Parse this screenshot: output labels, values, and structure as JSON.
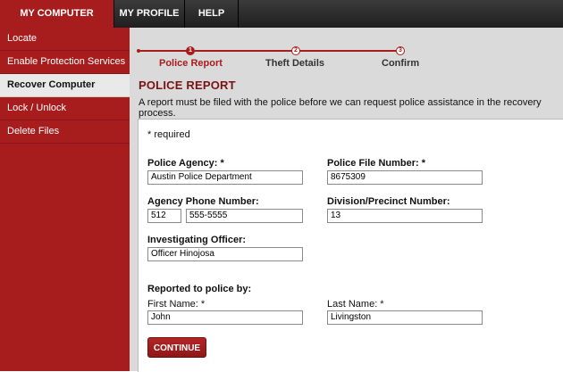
{
  "topnav": {
    "tabs": [
      {
        "label": "MY COMPUTER",
        "active": true
      },
      {
        "label": "MY PROFILE",
        "active": false
      },
      {
        "label": "HELP",
        "active": false
      }
    ]
  },
  "sidebar": {
    "items": [
      {
        "label": "Locate"
      },
      {
        "label": "Enable Protection Services"
      },
      {
        "label": "Recover Computer",
        "active": true
      },
      {
        "label": "Lock / Unlock"
      },
      {
        "label": "Delete Files"
      }
    ]
  },
  "steps": [
    {
      "number": "1",
      "label": "Police Report",
      "state": "current"
    },
    {
      "number": "2",
      "label": "Theft Details",
      "state": "pending"
    },
    {
      "number": "3",
      "label": "Confirm",
      "state": "pending"
    }
  ],
  "section": {
    "title": "POLICE REPORT",
    "description": "A report must be filed with the police before we can request police assistance in the recovery process."
  },
  "form": {
    "required_note": "* required",
    "police_agency": {
      "label": "Police Agency: *",
      "value": "Austin Police Department"
    },
    "police_file_number": {
      "label": "Police File Number: *",
      "value": "8675309"
    },
    "agency_phone": {
      "label": "Agency Phone Number:",
      "area_code": "512",
      "number": "555-5555"
    },
    "division_precinct": {
      "label": "Division/Precinct Number:",
      "value": "13"
    },
    "investigating_officer": {
      "label": "Investigating Officer:",
      "value": "Officer Hinojosa"
    },
    "reported_by": {
      "label": "Reported to police by:"
    },
    "first_name": {
      "label": "First Name: *",
      "value": "John"
    },
    "last_name": {
      "label": "Last Name: *",
      "value": "Livingston"
    },
    "continue_label": "CONTINUE"
  },
  "colors": {
    "brand_red": "#a71c1c",
    "title_red": "#7a1414",
    "nav_dark": "#2a2a2a"
  }
}
